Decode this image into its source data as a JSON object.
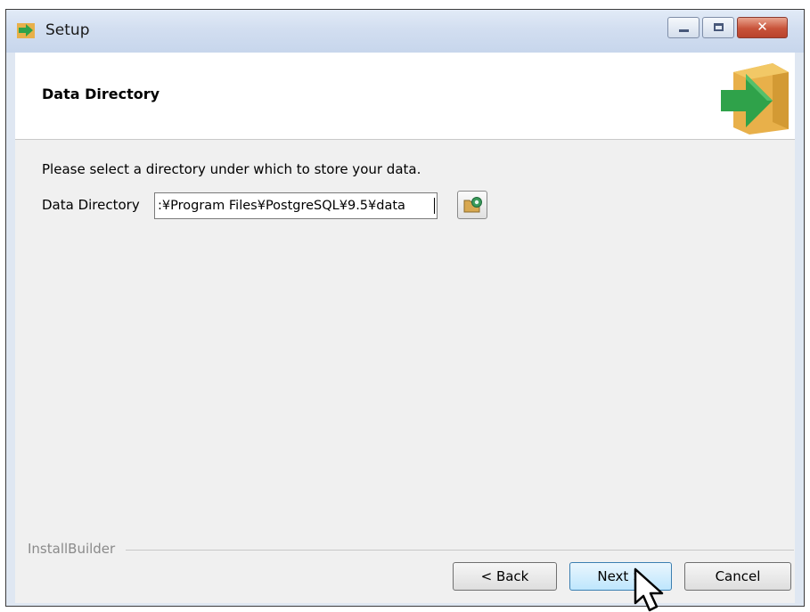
{
  "window": {
    "title": "Setup",
    "controls": {
      "minimize": "minimize-icon",
      "maximize": "maximize-icon",
      "close": "close-icon"
    }
  },
  "header": {
    "title": "Data Directory",
    "logo": "installer-box-arrow-icon"
  },
  "content": {
    "instruction": "Please select a directory under which to store your data.",
    "field_label": "Data Directory",
    "field_value": ":¥Program Files¥PostgreSQL¥9.5¥data",
    "browse_icon": "folder-browse-icon"
  },
  "footer": {
    "brand": "InstallBuilder",
    "back_label": "< Back",
    "next_label": "Next >",
    "cancel_label": "Cancel"
  },
  "colors": {
    "titlebar": "#d2def0",
    "content_bg": "#f0f0f0",
    "close_button": "#c8533a",
    "logo_box": "#e8b04a",
    "logo_arrow": "#2fa24a"
  }
}
